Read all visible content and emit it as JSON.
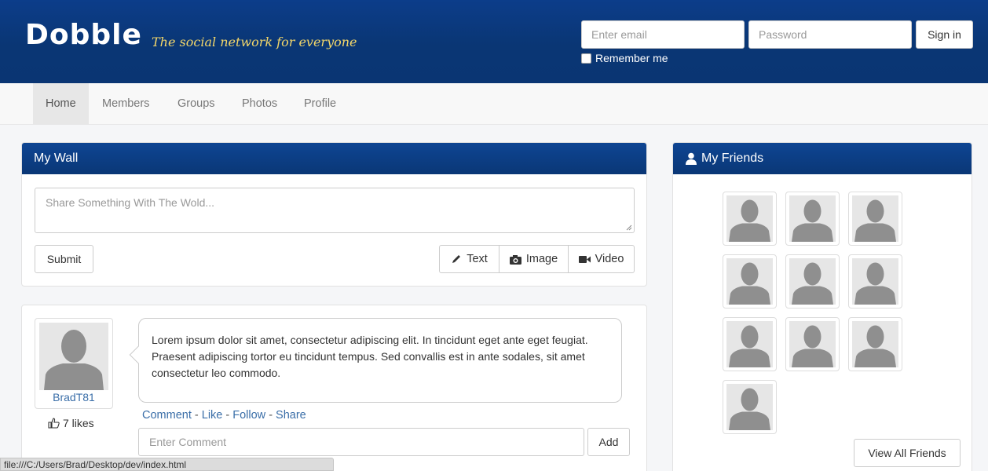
{
  "header": {
    "logo": "Dobble",
    "tagline": "The social network for everyone",
    "email_placeholder": "Enter email",
    "password_placeholder": "Password",
    "signin_label": "Sign in",
    "remember_label": "Remember me"
  },
  "nav": {
    "items": [
      {
        "label": "Home",
        "active": true
      },
      {
        "label": "Members"
      },
      {
        "label": "Groups"
      },
      {
        "label": "Photos"
      },
      {
        "label": "Profile"
      }
    ]
  },
  "wall": {
    "title": "My Wall",
    "share_placeholder": "Share Something With The Wold...",
    "submit_label": "Submit",
    "types": [
      {
        "label": "Text",
        "icon": "pencil-icon"
      },
      {
        "label": "Image",
        "icon": "camera-icon"
      },
      {
        "label": "Video",
        "icon": "video-camera-icon"
      }
    ]
  },
  "post": {
    "username": "BradT81",
    "likes": "7 likes",
    "text": "Lorem ipsum dolor sit amet, consectetur adipiscing elit. In tincidunt eget ante eget feugiat. Praesent adipiscing tortor eu tincidunt tempus. Sed convallis est in ante sodales, sit amet consectetur leo commodo.",
    "actions": [
      "Comment",
      "Like",
      "Follow",
      "Share"
    ],
    "comment_placeholder": "Enter Comment",
    "add_label": "Add"
  },
  "friends": {
    "title": "My Friends",
    "count_shown": 10,
    "view_all_label": "View All Friends"
  },
  "status_bar": {
    "url": "file:///C:/Users/Brad/Desktop/dev/index.html"
  },
  "colors": {
    "header_blue": "#0a3674",
    "tagline_yellow": "#f3d76a",
    "link_blue": "#3a6ea8"
  }
}
